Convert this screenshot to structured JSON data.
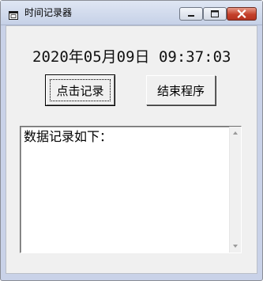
{
  "window": {
    "title": "时间记录器",
    "controls": {
      "minimize": "minimize-icon",
      "maximize": "maximize-icon",
      "close": "close-icon"
    }
  },
  "clock": {
    "datetime": "2020年05月09日 09:37:03"
  },
  "buttons": {
    "record_label": "点击记录",
    "exit_label": "结束程序"
  },
  "log": {
    "text": "数据记录如下："
  },
  "colors": {
    "titlebar": "#c9d2e8",
    "close_button": "#c4412b",
    "client_area": "#f0f0f0"
  }
}
